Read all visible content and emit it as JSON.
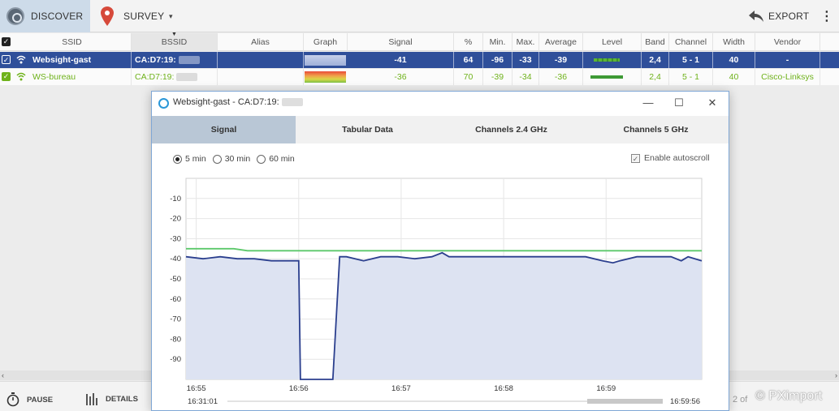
{
  "toolbar": {
    "discover_label": "DISCOVER",
    "survey_label": "SURVEY",
    "dropdown_glyph": "▾",
    "export_label": "EXPORT",
    "menu_glyph": "⋮"
  },
  "table": {
    "columns": [
      "SSID",
      "BSSID",
      "Alias",
      "Graph",
      "Signal",
      "%",
      "Min.",
      "Max.",
      "Average",
      "Level",
      "Band",
      "Channel",
      "Width",
      "Vendor"
    ],
    "sorted_column": "BSSID",
    "rows": [
      {
        "ssid": "Websight-gast",
        "bssid": "CA:D7:19:",
        "alias": "",
        "signal": "-41",
        "percent": "64",
        "min": "-96",
        "max": "-33",
        "average": "-39",
        "band": "2,4",
        "channel": "5 - 1",
        "width": "40",
        "vendor": "-",
        "selected": true,
        "checked": true,
        "level": 0.62
      },
      {
        "ssid": "WS-bureau",
        "bssid": "CA:D7:19:",
        "alias": "",
        "signal": "-36",
        "percent": "70",
        "min": "-39",
        "max": "-34",
        "average": "-36",
        "band": "2,4",
        "channel": "5 - 1",
        "width": "40",
        "vendor": "Cisco-Linksys",
        "selected": false,
        "checked": true,
        "level": 0.72
      }
    ]
  },
  "bottombar": {
    "pause_label": "PAUSE",
    "details_label": "DETAILS",
    "page_info": "2 of",
    "copyright": "© PXimport"
  },
  "popup": {
    "title": "Websight-gast - CA:D7:19:",
    "tabs": [
      "Signal",
      "Tabular Data",
      "Channels 2.4 GHz",
      "Channels 5 GHz"
    ],
    "active_tab": "Signal",
    "ranges": [
      "5 min",
      "30 min",
      "60 min"
    ],
    "selected_range": "5 min",
    "autoscroll_label": "Enable autoscroll",
    "autoscroll_checked": true,
    "time_start": "16:31:01",
    "time_end": "16:59:56",
    "window_buttons": {
      "minimize": "—",
      "maximize": "☐",
      "close": "✕"
    }
  },
  "chart_data": {
    "type": "line",
    "title": "",
    "xlabel": "",
    "ylabel": "",
    "x_ticks": [
      "16:55",
      "16:56",
      "16:57",
      "16:58",
      "16:59"
    ],
    "y_ticks": [
      -10,
      -20,
      -30,
      -40,
      -50,
      -60,
      -70,
      -80,
      -90
    ],
    "ylim": [
      -100,
      0
    ],
    "xlim": [
      "16:54:54",
      "16:59:56"
    ],
    "grid": true,
    "colors": {
      "series": "#2b3f8e",
      "fill": "#dde3f2",
      "reference": "#5cc86a",
      "grid": "#e6e6e6"
    },
    "series": [
      {
        "x": [
          "16:54:54",
          "16:55:04",
          "16:55:14",
          "16:55:24",
          "16:55:34",
          "16:55:44",
          "16:55:54",
          "16:56:00",
          "16:56:01",
          "16:56:20",
          "16:56:24",
          "16:56:28",
          "16:56:38",
          "16:56:48",
          "16:56:58",
          "16:57:08",
          "16:57:18",
          "16:57:24",
          "16:57:28",
          "16:57:38",
          "16:57:48",
          "16:57:58",
          "16:58:08",
          "16:58:18",
          "16:58:28",
          "16:58:38",
          "16:58:48",
          "16:58:58",
          "16:59:04",
          "16:59:08",
          "16:59:18",
          "16:59:28",
          "16:59:38",
          "16:59:44",
          "16:59:48",
          "16:59:56"
        ],
        "values": [
          -39,
          -40,
          -39,
          -40,
          -40,
          -41,
          -41,
          -41,
          -100,
          -100,
          -39,
          -39,
          -41,
          -39,
          -39,
          -40,
          -39,
          -37,
          -39,
          -39,
          -39,
          -39,
          -39,
          -39,
          -39,
          -39,
          -39,
          -41,
          -42,
          -41,
          -39,
          -39,
          -39,
          -41,
          -39,
          -41
        ]
      },
      {
        "x": [
          "16:54:54",
          "16:55:22",
          "16:55:30",
          "16:59:56"
        ],
        "values": [
          -35,
          -35,
          -36,
          -36
        ]
      }
    ]
  }
}
